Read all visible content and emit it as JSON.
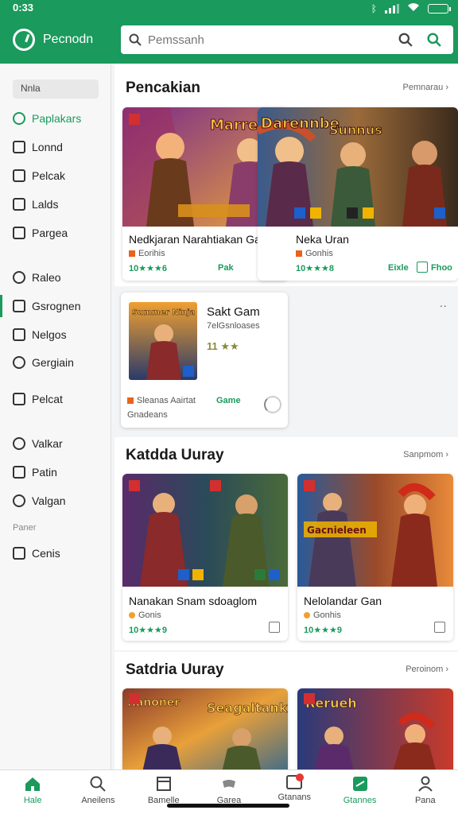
{
  "status": {
    "time": "0:33"
  },
  "header": {
    "app_name": "Pecnodn",
    "search_placeholder": "Pemssanh"
  },
  "sidebar": {
    "filter_label": "Nnla",
    "items": [
      {
        "label": "Paplakars",
        "icon": "compass-icon"
      },
      {
        "label": "Lonnd",
        "icon": "library-icon"
      },
      {
        "label": "Pelcak",
        "icon": "book-icon"
      },
      {
        "label": "Lalds",
        "icon": "grid-icon"
      },
      {
        "label": "Pargea",
        "icon": "page-icon"
      },
      {
        "label": "Raleo",
        "icon": "clock-icon"
      },
      {
        "label": "Gsrognen",
        "icon": "category-icon"
      },
      {
        "label": "Nelgos",
        "icon": "square-icon"
      },
      {
        "label": "Gergiain",
        "icon": "circle-icon"
      },
      {
        "label": "Pelcat",
        "icon": "gift-icon"
      },
      {
        "label": "Valkar",
        "icon": "tag-icon"
      },
      {
        "label": "Patin",
        "icon": "shield-icon"
      },
      {
        "label": "Valgan",
        "icon": "power-icon"
      },
      {
        "label": "Cenis",
        "icon": "box-icon"
      }
    ],
    "section_label": "Paner"
  },
  "sections": [
    {
      "title": "Pencakian",
      "more": "Pemnarau ›",
      "cards": [
        {
          "title": "Nedkjaran Narahtiakan Garno",
          "sub": "Eorihis",
          "rating": "10★★★6",
          "tag": "Pak",
          "art_text": [
            "Marrek",
            "Darennbe",
            "Sunnus"
          ]
        },
        {
          "title": "Neka Uran",
          "sub": "Gonhis",
          "rating": "10★★★8",
          "tag": "Eixle",
          "tag2": "Fhoo"
        }
      ]
    },
    {
      "title": "",
      "cards": [
        {
          "title": "Sakt Gam",
          "sub": "7elGsnloases",
          "rating": "11 ★★",
          "tag": "Game",
          "left_text": "Sleanas Aairtat",
          "extra": "Gnadeans",
          "art_text": "Summer Ninja"
        }
      ]
    },
    {
      "title": "Katdda Uuray",
      "more": "Sanpmom ›",
      "cards": [
        {
          "title": "Nanakan Snam sdoaglom",
          "sub": "Gonis",
          "rating": "10★★★9"
        },
        {
          "title": "Nelolandar Gan",
          "sub": "Gonhis",
          "rating": "10★★★9",
          "art_text": "Gacnieleen"
        }
      ]
    },
    {
      "title": "Satdria Uuray",
      "more": "Peroinom ›",
      "cards": [
        {
          "art_text": [
            "Ranoner",
            "Seagaltank"
          ]
        },
        {
          "art_text": "Rerueh"
        }
      ]
    }
  ],
  "bottom_nav": [
    {
      "label": "Hale",
      "icon": "home-icon",
      "active": true
    },
    {
      "label": "Aneilens",
      "icon": "search-icon"
    },
    {
      "label": "Bamelle",
      "icon": "library-icon"
    },
    {
      "label": "Garea",
      "icon": "controller-icon"
    },
    {
      "label": "Gtanans",
      "icon": "notifications-icon"
    },
    {
      "label": "Gtannes",
      "icon": "apps-icon",
      "active": true
    },
    {
      "label": "Pana",
      "icon": "profile-icon"
    }
  ],
  "colors": {
    "brand": "#1a9a5c",
    "accent_orange": "#e8641b",
    "badge_blue": "#1e5fc9",
    "badge_yellow": "#f0b400"
  }
}
